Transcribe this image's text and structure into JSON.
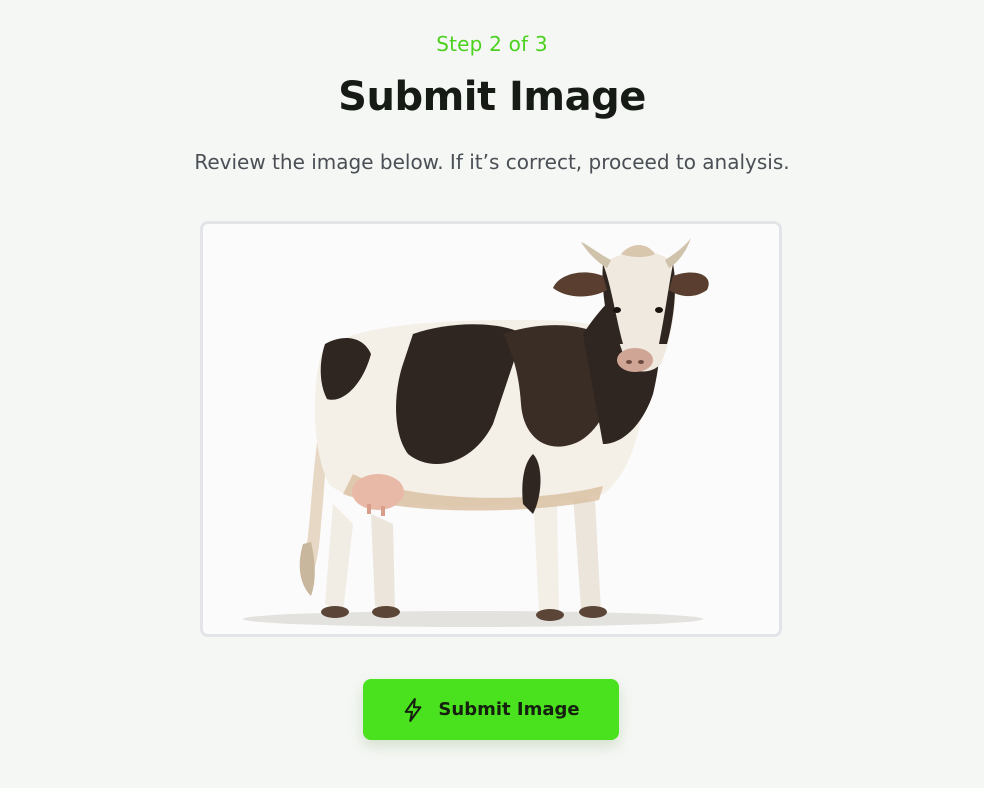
{
  "header": {
    "step": "Step 2 of 3",
    "title": "Submit Image",
    "subtitle": "Review the image below. If it’s correct, proceed to analysis."
  },
  "preview": {
    "subject": "cow"
  },
  "actions": {
    "submit_label": "Submit Image",
    "submit_icon": "lightning-bolt-icon"
  },
  "colors": {
    "accent": "#4ae11e",
    "step_text": "#4cd11f",
    "background": "#f5f7f4"
  }
}
